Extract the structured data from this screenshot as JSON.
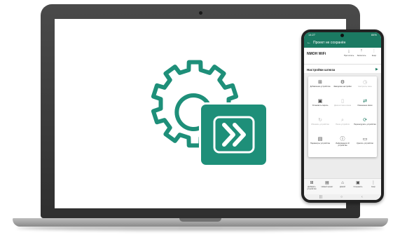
{
  "logo": {
    "name": "gear-fast-forward-logo",
    "color": "#1e8f79"
  },
  "phone": {
    "status": {
      "time": "14:27",
      "right": "84%"
    },
    "appbar": {
      "title": "Проект не сохранён",
      "back_icon": "arrow-left-icon",
      "more_icon": "more-vert-icon"
    },
    "device_name": "NMOH WiFi",
    "toolbar": [
      {
        "icon": "download-icon",
        "label": "Прочитать"
      },
      {
        "icon": "upload-icon",
        "label": "Записать"
      },
      {
        "icon": "more-vert-icon",
        "label": "Ещё"
      }
    ],
    "section_title": "Настройки шлюза",
    "menu": [
      {
        "icon": "add-device-icon",
        "label": "Добавление устройства",
        "enabled": true
      },
      {
        "icon": "settings-icon",
        "label": "Заводские настройки",
        "enabled": true
      },
      {
        "icon": "clock-icon",
        "label": "Настроить часы",
        "enabled": false
      },
      {
        "icon": "lock-icon",
        "label": "Установить пароль",
        "enabled": true
      },
      {
        "icon": "file-icon",
        "label": "Диагностика шлюза",
        "enabled": false
      },
      {
        "icon": "swap-icon",
        "label": "Изменение связи",
        "enabled": true
      },
      {
        "icon": "refresh-icon",
        "label": "Обновить устройство",
        "enabled": false
      },
      {
        "icon": "search-icon",
        "label": "Поиск устройств",
        "enabled": false
      },
      {
        "icon": "restart-icon",
        "label": "Перезагрузить устройство",
        "enabled": true
      },
      {
        "icon": "device-settings-icon",
        "label": "Параметры устройства",
        "enabled": true
      },
      {
        "icon": "info-icon",
        "label": "Информация об устройстве",
        "enabled": true
      },
      {
        "icon": "delete-icon",
        "label": "Удалить устройство",
        "enabled": true
      }
    ],
    "bottom_bar": [
      {
        "icon": "add-device-icon",
        "label": "Добавить устройство"
      },
      {
        "icon": "new-project-icon",
        "label": "Новый проект"
      },
      {
        "icon": "home-icon",
        "label": "Домой"
      },
      {
        "icon": "save-icon",
        "label": "Сохранить"
      },
      {
        "icon": "more-vert-icon",
        "label": "Ещё"
      }
    ]
  }
}
